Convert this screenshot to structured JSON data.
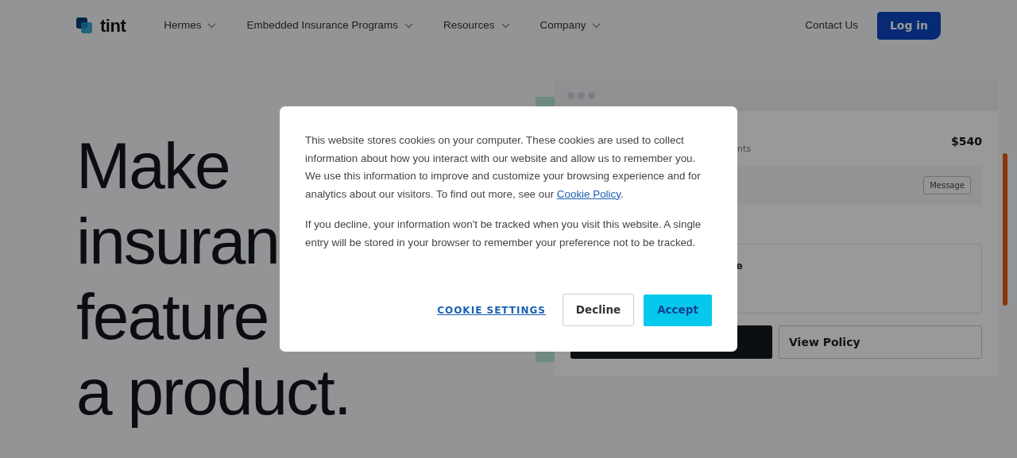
{
  "navbar": {
    "logo": "tint",
    "menus": [
      {
        "label": "Hermes"
      },
      {
        "label": "Embedded Insurance Programs"
      },
      {
        "label": "Resources"
      },
      {
        "label": "Company"
      }
    ],
    "contact": "Contact Us",
    "login": "Log in"
  },
  "hero": {
    "lines": [
      "Make",
      "insuran",
      "feature",
      "a product."
    ]
  },
  "mockup": {
    "amount": "$540",
    "subtitle_fragment": "nts",
    "message_button": "Message",
    "card_title_fragment": "e",
    "view_policy_button": "View Policy"
  },
  "cookie_dialog": {
    "paragraph_1": "This website stores cookies on your computer. These cookies are used to collect information about how you interact with our website and allow us to remember you. We use this information to improve and customize your browsing experience and for analytics about our visitors. To find out more, see our ",
    "policy_link": "Cookie Policy",
    "paragraph_1_end": ".",
    "paragraph_2": "If you decline, your information won't be tracked when you visit this website. A single entry will be stored in your browser to remember your preference not to be tracked.",
    "settings_link": "COOKIE SETTINGS",
    "decline": "Decline",
    "accept": "Accept"
  }
}
